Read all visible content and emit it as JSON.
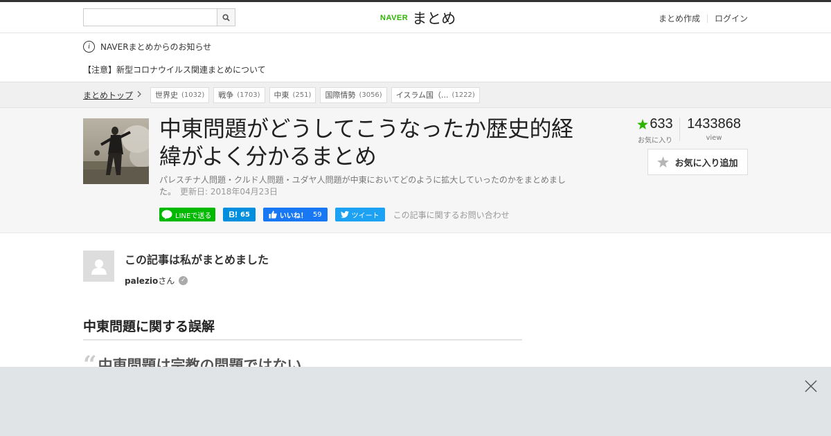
{
  "header": {
    "search_placeholder": "",
    "logo_brand": "NAVER",
    "logo_name": "まとめ",
    "nav_create": "まとめ作成",
    "nav_login": "ログイン"
  },
  "notice": {
    "title": "NAVERまとめからのお知らせ",
    "item": "【注意】新型コロナウイルス関連まとめについて"
  },
  "breadcrumb": {
    "top_label": "まとめトップ",
    "tags": [
      {
        "label": "世界史",
        "count": "(1032)"
      },
      {
        "label": "戦争",
        "count": "(1703)"
      },
      {
        "label": "中東",
        "count": "(251)"
      },
      {
        "label": "国際情勢",
        "count": "(3056)"
      },
      {
        "label": "イスラム国（...",
        "count": "(1222)"
      }
    ]
  },
  "article": {
    "title": "中東問題がどうしてこうなったか歴史的経緯がよく分かるまとめ",
    "description": "パレスチナ人問題・クルド人問題・ユダヤ人問題が中東においてどのように拡大していったのかをまとめました。",
    "updated": "更新日: 2018年04月23日",
    "share": {
      "line_label": "LINEで送る",
      "hatena_count": "65",
      "fb_label": "いいね！",
      "fb_count": "59",
      "tw_label": "ツイート",
      "contact_label": "この記事に関するお問い合わせ"
    },
    "favorites": "633",
    "favorites_label": "お気に入り",
    "views": "1433868",
    "views_label": "view",
    "fav_button_label": "お気に入り追加"
  },
  "author": {
    "heading": "この記事は私がまとめました",
    "username": "palezio",
    "suffix": "さん"
  },
  "content": {
    "section_heading": "中東問題に関する誤解",
    "quote_text": "中東問題は宗教の問題ではない"
  },
  "colors": {
    "accent_green": "#2db400",
    "overlay": "#e1e4e6"
  }
}
